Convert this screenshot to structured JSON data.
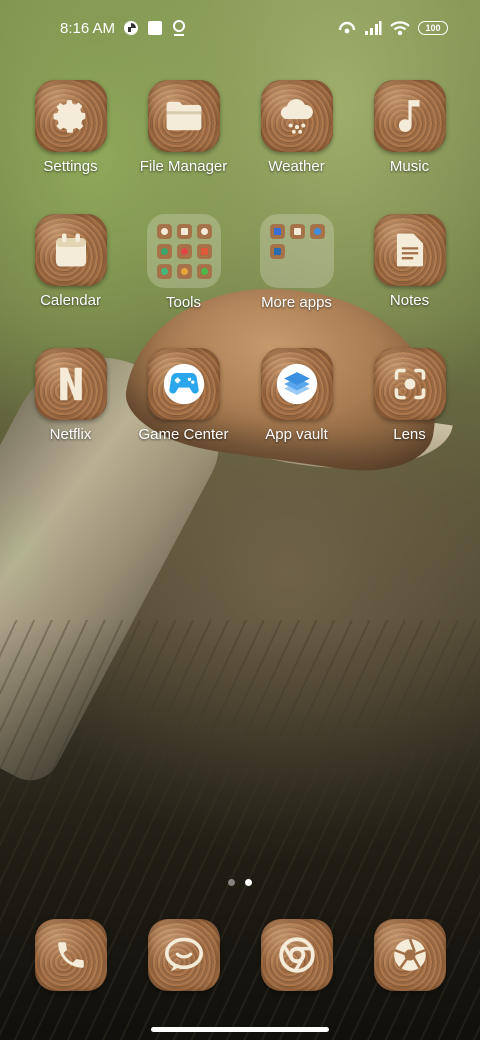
{
  "status_bar": {
    "time": "8:16 AM",
    "battery": "100",
    "left_icons": [
      "data-saver-icon",
      "notification-square-icon",
      "location-pin-icon"
    ],
    "right_icons": [
      "hotspot-icon",
      "signal-bars-icon",
      "wifi-icon"
    ]
  },
  "apps": [
    {
      "label": "Settings",
      "icon": "gear-icon"
    },
    {
      "label": "File Manager",
      "icon": "folder-icon"
    },
    {
      "label": "Weather",
      "icon": "cloud-snow-icon"
    },
    {
      "label": "Music",
      "icon": "music-note-icon"
    },
    {
      "label": "Calendar",
      "icon": "calendar-icon"
    },
    {
      "label": "Tools",
      "icon": "folder-icon"
    },
    {
      "label": "More apps",
      "icon": "folder-icon"
    },
    {
      "label": "Notes",
      "icon": "note-icon"
    },
    {
      "label": "Netflix",
      "icon": "netflix-icon"
    },
    {
      "label": "Game Center",
      "icon": "gamepad-icon"
    },
    {
      "label": "App vault",
      "icon": "layers-icon"
    },
    {
      "label": "Lens",
      "icon": "lens-scan-icon"
    }
  ],
  "page_indicator": {
    "pages": 2,
    "active": 2
  },
  "dock": [
    {
      "icon": "phone-icon"
    },
    {
      "icon": "messages-icon"
    },
    {
      "icon": "chrome-icon"
    },
    {
      "icon": "camera-aperture-icon"
    }
  ],
  "colors": {
    "icon_base": "#a06f47",
    "icon_glyph": "#f4ecd8",
    "game_center_blue": "#2aa7ec",
    "app_vault_blue": "#3b8fe0"
  }
}
